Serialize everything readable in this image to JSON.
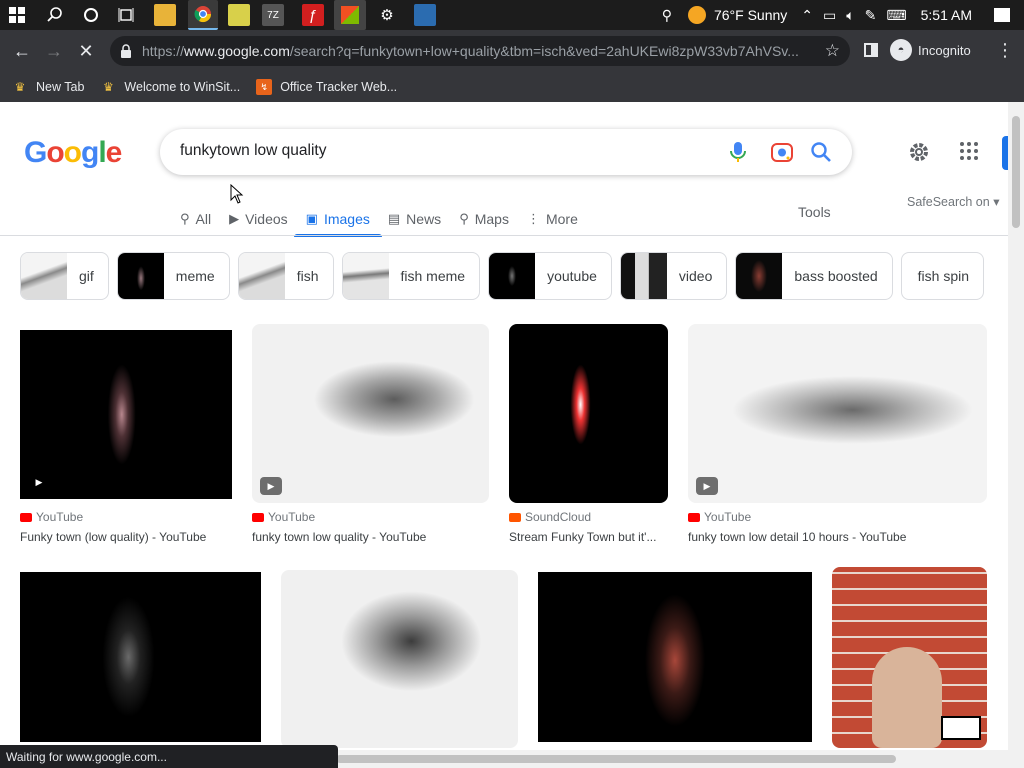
{
  "taskbar": {
    "weather": "76°F Sunny",
    "time": "5:51 AM"
  },
  "browser": {
    "url_prefix": "https://",
    "url_host": "www.google.com",
    "url_rest": "/search?q=funkytown+low+quality&tbm=isch&ved=2ahUKEwi8zpW33vb7AhVSv...",
    "incognito_label": "Incognito",
    "bookmarks": [
      {
        "label": "New Tab",
        "icon": "winsite-icon"
      },
      {
        "label": "Welcome to WinSit...",
        "icon": "winsite-icon"
      },
      {
        "label": "Office Tracker Web...",
        "icon": "office-tracker-icon"
      }
    ],
    "status": "Waiting for www.google.com..."
  },
  "search": {
    "query": "funkytown low quality",
    "safesearch": "SafeSearch on",
    "tools": "Tools"
  },
  "tabs": [
    {
      "label": "All",
      "icon": "search-icon"
    },
    {
      "label": "Videos",
      "icon": "video-icon"
    },
    {
      "label": "Images",
      "icon": "image-icon",
      "active": true
    },
    {
      "label": "News",
      "icon": "news-icon"
    },
    {
      "label": "Maps",
      "icon": "map-pin-icon"
    },
    {
      "label": "More",
      "icon": "more-vert-icon"
    }
  ],
  "chips": [
    "gif",
    "meme",
    "fish",
    "fish meme",
    "youtube",
    "video",
    "bass boosted",
    "fish spin"
  ],
  "results": [
    {
      "source": "YouTube",
      "title": "Funky town (low quality) - YouTube"
    },
    {
      "source": "YouTube",
      "title": "funky town low quality - YouTube"
    },
    {
      "source": "SoundCloud",
      "title": "Stream Funky Town but it'..."
    },
    {
      "source": "YouTube",
      "title": "funky town low detail 10 hours - YouTube"
    }
  ],
  "colors": {
    "youtube": "#ff0000",
    "soundcloud": "#ff5500",
    "accent": "#1a73e8"
  }
}
